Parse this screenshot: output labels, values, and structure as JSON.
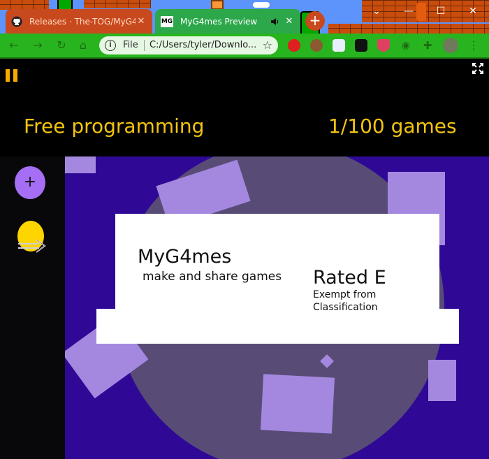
{
  "browser": {
    "tabs": [
      {
        "title": "Releases · The-TOG/MyG4…",
        "icon": "github-icon",
        "active": false
      },
      {
        "title": "MyG4mes Preview",
        "icon": "myg4mes-favicon",
        "favicon_text": "MG",
        "audio_icon": "speaker-icon",
        "active": true
      }
    ],
    "new_tab_label": "+",
    "address": {
      "scheme": "File",
      "url": "C:/Users/tyler/Downlo..."
    },
    "window_controls": {
      "collapse": "⌄",
      "minimize": "—",
      "maximize": "☐",
      "close": "✕"
    },
    "theme_colors": {
      "sky": "#5c94fc",
      "brick": "#c84c0c",
      "toolbar": "#28b41e"
    }
  },
  "game": {
    "header_left": "Free programming",
    "header_right": "1/100 games",
    "add_button": "+",
    "logo_title": "MyG4mes",
    "logo_subtitle": "make and share games",
    "rating": "Rated E",
    "rating_description": "Exempt from Classification",
    "accent_color": "#f2c40f",
    "purple": "#a56ef5"
  }
}
